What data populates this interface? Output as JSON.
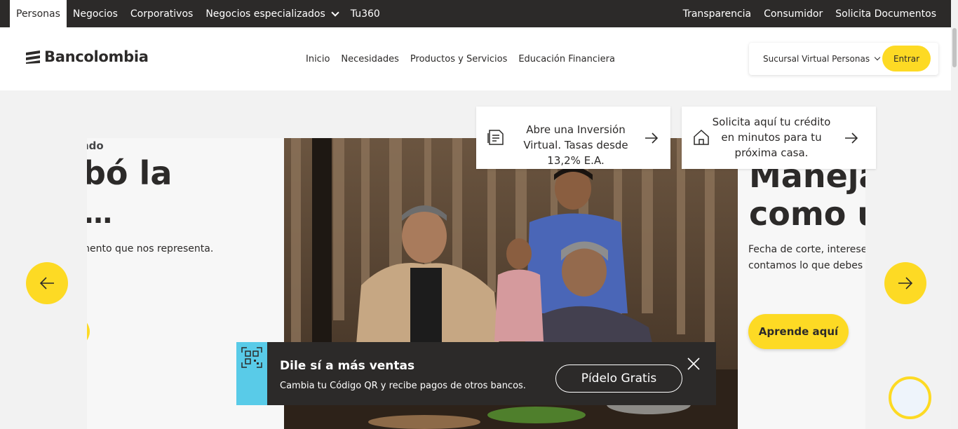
{
  "topbar": {
    "left_tabs": [
      "Personas",
      "Negocios",
      "Corporativos",
      "Negocios especializados",
      "Tu360"
    ],
    "active_tab": "Personas",
    "right_links": [
      "Transparencia",
      "Consumidor",
      "Solicita Documentos"
    ]
  },
  "header": {
    "logo_text": "Bancolombia",
    "nav": [
      "Inicio",
      "Necesidades",
      "Productos y Servicios",
      "Educación Financiera"
    ],
    "access_select": "Sucursal Virtual Personas",
    "login_label": "Entrar"
  },
  "cards": [
    {
      "text": "Abre una Inversión Virtual. Tasas desde 13,2% E.A.",
      "icon": "document-icon"
    },
    {
      "text": "Solicita aquí tu crédito en minutos para tu próxima casa.",
      "icon": "house-icon"
    }
  ],
  "carousel": {
    "left": {
      "kicker": "ndo",
      "title_line1": "bó la",
      "title_line2": "…",
      "subtitle": "alimento que nos representa."
    },
    "right": {
      "title_line1": "Maneja",
      "title_line2": "como u",
      "subtitle_line1": "Fecha de corte, interese",
      "subtitle_line2": "contamos lo que debes",
      "cta": "Aprende aquí"
    }
  },
  "qr_banner": {
    "title": "Dile sí a más ventas",
    "description": "Cambia tu Código QR y recibe pagos de otros bancos.",
    "button": "Pídelo Gratis"
  },
  "colors": {
    "brand_yellow": "#fdda24",
    "dark": "#2c2a29",
    "qr_accent": "#59cbe8"
  }
}
